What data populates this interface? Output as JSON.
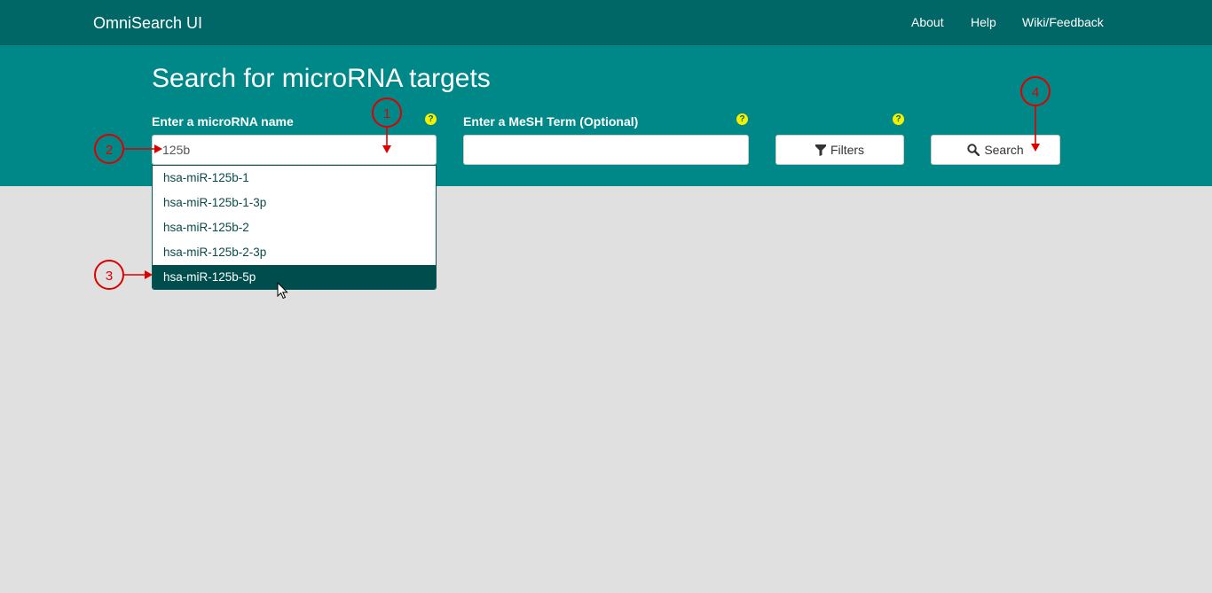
{
  "nav": {
    "brand": "OmniSearch UI",
    "links": [
      "About",
      "Help",
      "Wiki/Feedback"
    ]
  },
  "hero": {
    "title": "Search for microRNA targets"
  },
  "mirna": {
    "label": "Enter a microRNA name",
    "value": "125b",
    "help": "?"
  },
  "mesh": {
    "label": "Enter a MeSH Term (Optional)",
    "value": "",
    "help": "?"
  },
  "filters": {
    "label": "Filters",
    "help": "?"
  },
  "search": {
    "label": "Search"
  },
  "dropdown": {
    "items": [
      "hsa-miR-125b-1",
      "hsa-miR-125b-1-3p",
      "hsa-miR-125b-2",
      "hsa-miR-125b-2-3p",
      "hsa-miR-125b-5p"
    ],
    "selected_index": 4
  },
  "annotations": [
    "1",
    "2",
    "3",
    "4"
  ],
  "colors": {
    "navbar": "#006666",
    "hero": "#008888",
    "page_bg": "#e0e0e0",
    "help_icon": "#f3f000",
    "selected_item": "#004d4d",
    "annotation": "#dd0000"
  },
  "icons": {
    "filter": "filter-icon",
    "search": "magnifier-icon",
    "help": "question-circle-icon",
    "cursor": "mouse-pointer-icon"
  }
}
